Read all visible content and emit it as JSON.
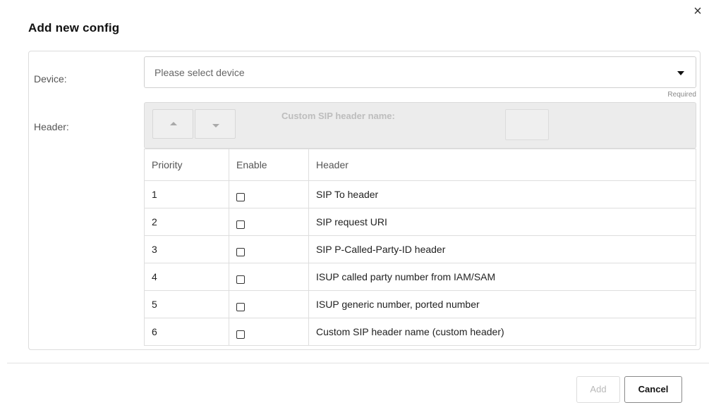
{
  "dialog": {
    "title": "Add new config",
    "close_glyph": "×"
  },
  "form": {
    "device": {
      "label": "Device:",
      "placeholder": "Please select device",
      "hint": "Required"
    },
    "header": {
      "label": "Header:",
      "custom_header_label": "Custom SIP header name:",
      "move_up_icon": "triangle-up",
      "move_down_icon": "triangle-down"
    }
  },
  "table": {
    "columns": [
      "Priority",
      "Enable",
      "Header"
    ],
    "rows": [
      {
        "priority": "1",
        "enabled": false,
        "header": "SIP To header"
      },
      {
        "priority": "2",
        "enabled": false,
        "header": "SIP request URI"
      },
      {
        "priority": "3",
        "enabled": false,
        "header": "SIP P-Called-Party-ID header"
      },
      {
        "priority": "4",
        "enabled": false,
        "header": "ISUP called party number from IAM/SAM"
      },
      {
        "priority": "5",
        "enabled": false,
        "header": "ISUP generic number, ported number"
      },
      {
        "priority": "6",
        "enabled": false,
        "header": "Custom SIP header name (custom header)"
      }
    ]
  },
  "footer": {
    "add_label": "Add",
    "cancel_label": "Cancel"
  }
}
